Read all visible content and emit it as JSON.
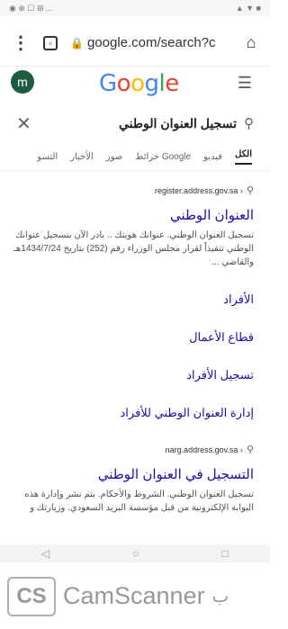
{
  "status_bar": {
    "left": "◉ ⊕ ☐ ⊞ ...",
    "right": "▲ ▼ ■"
  },
  "browser": {
    "url": "google.com/search?c"
  },
  "header": {
    "avatar_letter": "m",
    "logo": [
      "G",
      "o",
      "o",
      "g",
      "l",
      "e"
    ]
  },
  "search": {
    "query": "تسجيل العنوان الوطني"
  },
  "filters": {
    "tabs": [
      "الكل",
      "فيديو",
      "خرائط Google",
      "صور",
      "الأخبار",
      "التسو"
    ]
  },
  "results": [
    {
      "source": "register.address.gov.sa ›",
      "title": "العنوان الوطني",
      "snippet": "تسجيل العنوان الوطني. عنوانك هويتك .. بادر الآن بتسجيل عنوانك الوطني تنفيذاً لقرار مجلس الوزراء رقم (252) بتاريخ 1434/7/24هـ والقاضي ..."
    },
    {
      "source": "narg.address.gov.sa ›",
      "title": "التسجيل في العنوان الوطني",
      "snippet": "تسجيل العنوان الوطني. الشروط والأحكام. يتم نشر وإدارة هذه البوابة الإلكترونية من قبل مؤسسة البريد السعودي. وزيارتك و"
    }
  ],
  "sitelinks": [
    "الأفراد",
    "قطاع الأعمال",
    "تسجيل الأفراد",
    "إدارة العنوان الوطني للأفراد"
  ],
  "footer": {
    "brand": "CamScanner",
    "logo": "CS",
    "prefix": "ب"
  },
  "colors": {
    "link": "#1a0dab",
    "avatar": "#1e5c3f",
    "g_blue": "#4285F4",
    "g_red": "#EA4335",
    "g_yellow": "#FBBC05",
    "g_green": "#34A853"
  }
}
